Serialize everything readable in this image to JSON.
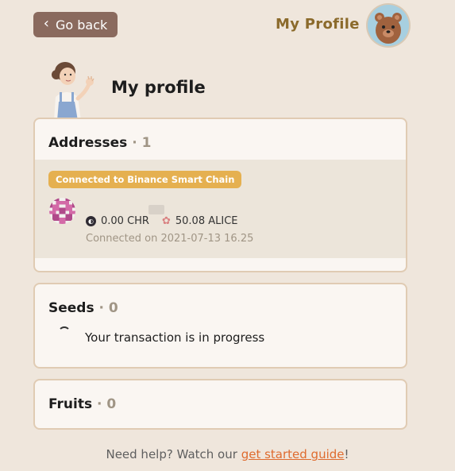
{
  "nav": {
    "back_label": "Go back",
    "header_title": "My Profile",
    "avatar_icon": "bear-avatar-icon"
  },
  "page": {
    "title": "My profile"
  },
  "addresses": {
    "label": "Addresses",
    "separator": "·",
    "count": "1",
    "items": [
      {
        "chain_badge": "Connected to Binance Smart Chain",
        "chr_balance": "0.00 CHR",
        "alice_balance": "50.08 ALICE",
        "connected_on": "Connected on 2021-07-13 16.25"
      }
    ]
  },
  "seeds": {
    "label": "Seeds",
    "separator": "·",
    "count": "0",
    "status": "Your transaction is in progress"
  },
  "fruits": {
    "label": "Fruits",
    "separator": "·",
    "count": "0"
  },
  "help": {
    "prefix": "Need help? Watch our ",
    "link_label": "get started guide",
    "suffix": "!"
  },
  "colors": {
    "background": "#efe6dc",
    "back_button": "#8a6a5e",
    "header_title": "#8b6a2b",
    "badge": "#e5b050",
    "link": "#df6b2e"
  }
}
